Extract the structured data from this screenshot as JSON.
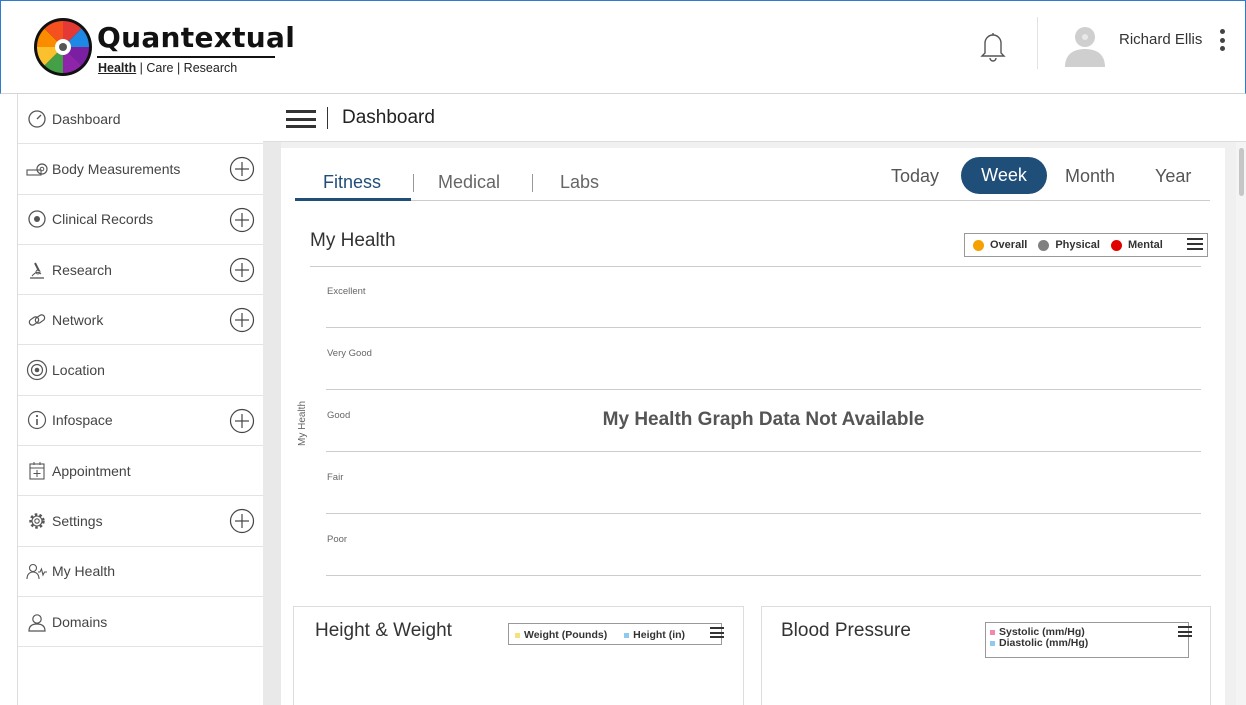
{
  "brand": {
    "name": "Quantextual",
    "sub_health": "Health",
    "sub_rest": " | Care | Research"
  },
  "user": {
    "name": "Richard Ellis"
  },
  "sidebar": {
    "items": [
      {
        "label": "Dashboard",
        "icon": "gauge-icon",
        "has_add": false
      },
      {
        "label": "Body Measurements",
        "icon": "tape-measure-icon",
        "has_add": true
      },
      {
        "label": "Clinical Records",
        "icon": "record-dot-icon",
        "has_add": true
      },
      {
        "label": "Research",
        "icon": "microscope-icon",
        "has_add": true
      },
      {
        "label": "Network",
        "icon": "link-icon",
        "has_add": true
      },
      {
        "label": "Location",
        "icon": "target-icon",
        "has_add": false
      },
      {
        "label": "Infospace",
        "icon": "info-icon",
        "has_add": true
      },
      {
        "label": "Appointment",
        "icon": "calendar-icon",
        "has_add": false
      },
      {
        "label": "Settings",
        "icon": "gear-icon",
        "has_add": true
      },
      {
        "label": "My Health",
        "icon": "users-health-icon",
        "has_add": false
      },
      {
        "label": "Domains",
        "icon": "user-icon",
        "has_add": false
      }
    ]
  },
  "topbar": {
    "title": "Dashboard"
  },
  "tabs": [
    "Fitness",
    "Medical",
    "Labs"
  ],
  "periods": [
    "Today",
    "Week",
    "Month",
    "Year"
  ],
  "active_period": "Week",
  "my_health": {
    "title": "My Health",
    "legend": [
      {
        "name": "Overall",
        "color": "#f5a100"
      },
      {
        "name": "Physical",
        "color": "#808080"
      },
      {
        "name": "Mental",
        "color": "#e00000"
      }
    ],
    "y_axis_title": "My Health",
    "ticks": [
      "Excellent",
      "Very Good",
      "Good",
      "Fair",
      "Poor"
    ],
    "no_data": "My Health Graph Data Not Available"
  },
  "height_weight": {
    "title": "Height & Weight",
    "legend": [
      {
        "name": "Weight (Pounds)",
        "color": "#f5e27a"
      },
      {
        "name": "Height (in)",
        "color": "#8ec9f0"
      }
    ]
  },
  "blood_pressure": {
    "title": "Blood Pressure",
    "legend": [
      {
        "name": "Systolic (mm/Hg)",
        "color": "#f08aa8"
      },
      {
        "name": "Diastolic (mm/Hg)",
        "color": "#8ec9f0"
      }
    ]
  },
  "colors": {
    "accent": "#1f4e79",
    "border": "#2e7bd0"
  }
}
